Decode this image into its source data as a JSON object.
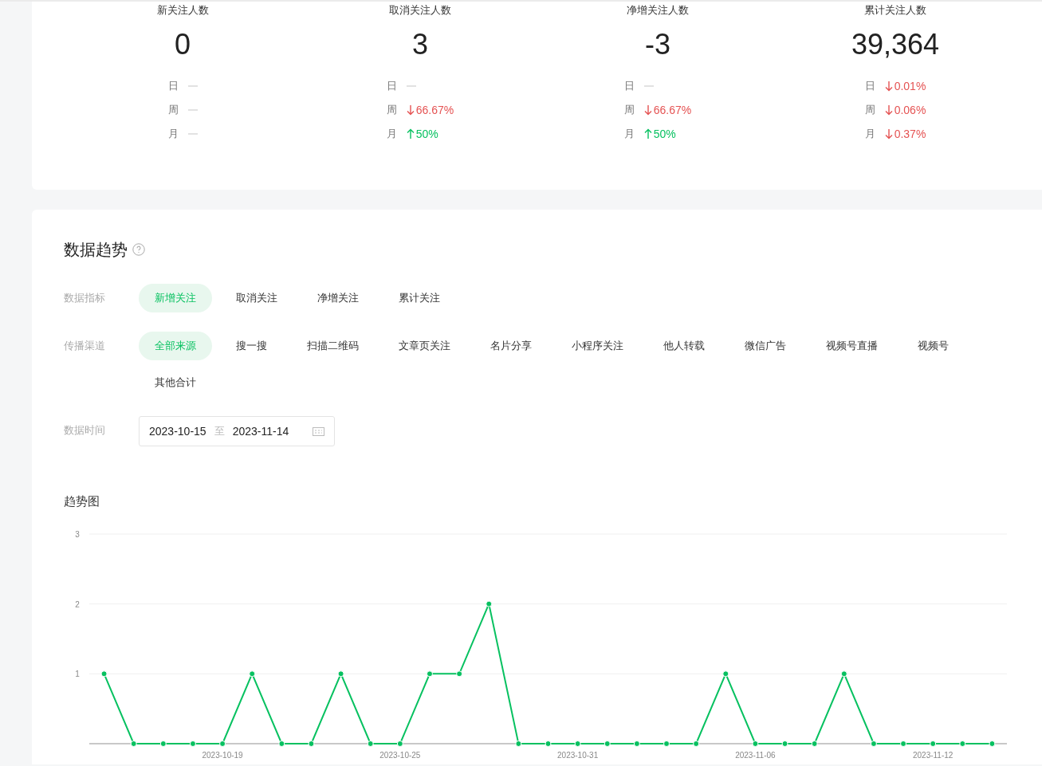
{
  "stats": [
    {
      "title": "新关注人数",
      "value": "0",
      "changes": [
        {
          "period": "日",
          "kind": "none"
        },
        {
          "period": "周",
          "kind": "none"
        },
        {
          "period": "月",
          "kind": "none"
        }
      ]
    },
    {
      "title": "取消关注人数",
      "value": "3",
      "changes": [
        {
          "period": "日",
          "kind": "none"
        },
        {
          "period": "周",
          "kind": "down",
          "text": "66.67%"
        },
        {
          "period": "月",
          "kind": "up",
          "text": "50%"
        }
      ]
    },
    {
      "title": "净增关注人数",
      "value": "-3",
      "changes": [
        {
          "period": "日",
          "kind": "none"
        },
        {
          "period": "周",
          "kind": "down",
          "text": "66.67%"
        },
        {
          "period": "月",
          "kind": "up",
          "text": "50%"
        }
      ]
    },
    {
      "title": "累计关注人数",
      "value": "39,364",
      "changes": [
        {
          "period": "日",
          "kind": "down",
          "text": "0.01%"
        },
        {
          "period": "周",
          "kind": "down",
          "text": "0.06%"
        },
        {
          "period": "月",
          "kind": "down",
          "text": "0.37%"
        }
      ]
    }
  ],
  "trend": {
    "title": "数据趋势",
    "filters": [
      {
        "label": "数据指标",
        "options": [
          {
            "label": "新增关注",
            "selected": true
          },
          {
            "label": "取消关注",
            "selected": false
          },
          {
            "label": "净增关注",
            "selected": false
          },
          {
            "label": "累计关注",
            "selected": false
          }
        ]
      },
      {
        "label": "传播渠道",
        "options": [
          {
            "label": "全部来源",
            "selected": true
          },
          {
            "label": "搜一搜",
            "selected": false
          },
          {
            "label": "扫描二维码",
            "selected": false
          },
          {
            "label": "文章页关注",
            "selected": false
          },
          {
            "label": "名片分享",
            "selected": false
          },
          {
            "label": "小程序关注",
            "selected": false
          },
          {
            "label": "他人转载",
            "selected": false
          },
          {
            "label": "微信广告",
            "selected": false
          },
          {
            "label": "视频号直播",
            "selected": false
          },
          {
            "label": "视频号",
            "selected": false
          },
          {
            "label": "其他合计",
            "selected": false
          }
        ]
      }
    ],
    "date_range": {
      "label": "数据时间",
      "start": "2023-10-15",
      "separator": "至",
      "end": "2023-11-14"
    },
    "chart_title": "趋势图",
    "chart_data": {
      "type": "line",
      "ylim": [
        0,
        3
      ],
      "yticks": [
        1,
        2,
        3
      ],
      "categories": [
        null,
        null,
        null,
        null,
        "2023-10-19",
        null,
        null,
        null,
        null,
        null,
        "2023-10-25",
        null,
        null,
        null,
        null,
        null,
        "2023-10-31",
        null,
        null,
        null,
        null,
        null,
        "2023-11-06",
        null,
        null,
        null,
        null,
        null,
        "2023-11-12",
        null,
        null
      ],
      "series": [
        {
          "color": "#07c160",
          "marker": "circle",
          "values": [
            1,
            0,
            0,
            0,
            0,
            1,
            0,
            0,
            1,
            0,
            0,
            1,
            1,
            2,
            0,
            0,
            0,
            0,
            0,
            0,
            0,
            1,
            0,
            0,
            0,
            1,
            0,
            0,
            0,
            0,
            0
          ]
        }
      ]
    }
  }
}
